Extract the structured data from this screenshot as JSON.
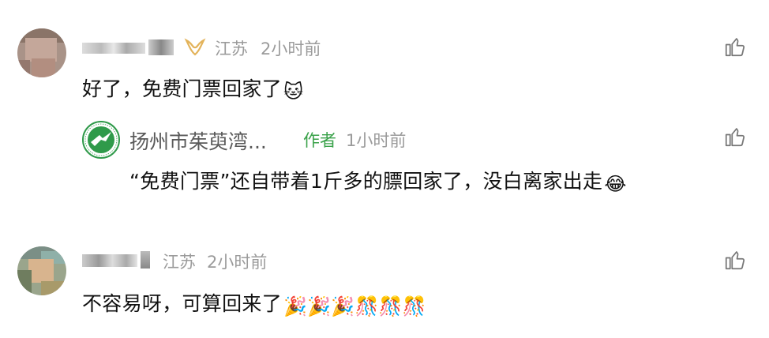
{
  "comments": [
    {
      "location": "江苏",
      "time": "2小时前",
      "text": "好了，免费门票回家了",
      "emoji": "🐱",
      "reply": {
        "name": "扬州市茱萸湾...",
        "author_tag": "作者",
        "time": "1小时前",
        "text": "“免费门票”还自带着1斤多的膘回家了，没白离家出走",
        "emoji": "😂"
      }
    },
    {
      "location": "江苏",
      "time": "2小时前",
      "text": "不容易呀，可算回来了",
      "emoji": "🎉🎉🎉🎊🎊🎊"
    }
  ],
  "icons": {
    "like": "thumbs-up-icon",
    "badge": "butterfly-badge-icon",
    "org_logo": "zoo-logo-icon"
  },
  "colors": {
    "meta_gray": "#9b9b9b",
    "author_green": "#3aa24a",
    "badge_gold": "#e3b35a"
  }
}
